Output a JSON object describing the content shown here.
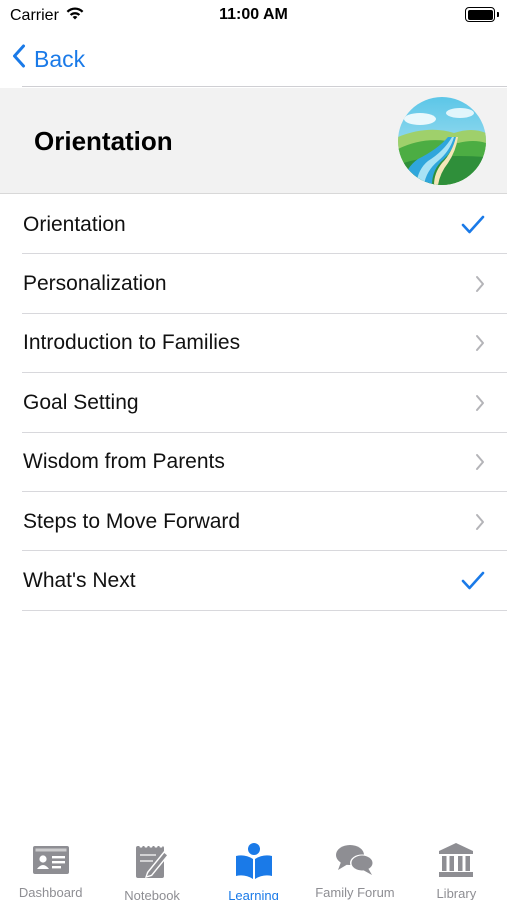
{
  "status_bar": {
    "carrier": "Carrier",
    "time": "11:00 AM",
    "icons": [
      "wifi-icon",
      "battery-icon"
    ]
  },
  "nav": {
    "back_label": "Back",
    "back_icon": "chevron-left-icon"
  },
  "header": {
    "title": "Orientation",
    "image": "landscape-river-illustration"
  },
  "list": {
    "items": [
      {
        "label": "Orientation",
        "accessory": "checkmark-icon"
      },
      {
        "label": "Personalization",
        "accessory": "chevron-right-icon"
      },
      {
        "label": "Introduction to Families",
        "accessory": "chevron-right-icon"
      },
      {
        "label": "Goal Setting",
        "accessory": "chevron-right-icon"
      },
      {
        "label": "Wisdom from Parents",
        "accessory": "chevron-right-icon"
      },
      {
        "label": "Steps to Move Forward",
        "accessory": "chevron-right-icon"
      },
      {
        "label": "What's Next",
        "accessory": "checkmark-icon"
      }
    ]
  },
  "tab_bar": {
    "tabs": [
      {
        "label": "Dashboard",
        "icon": "id-card-icon",
        "active": false
      },
      {
        "label": "Notebook",
        "icon": "notebook-pencil-icon",
        "active": false
      },
      {
        "label": "Learning",
        "icon": "reader-book-icon",
        "active": true
      },
      {
        "label": "Family Forum",
        "icon": "chat-bubbles-icon",
        "active": false
      },
      {
        "label": "Library",
        "icon": "library-building-icon",
        "active": false
      }
    ]
  },
  "colors": {
    "accent": "#1a7ae8",
    "inactive": "#8e8e93",
    "header_bg": "#f2f2f2",
    "separator": "#d8d8dc"
  }
}
